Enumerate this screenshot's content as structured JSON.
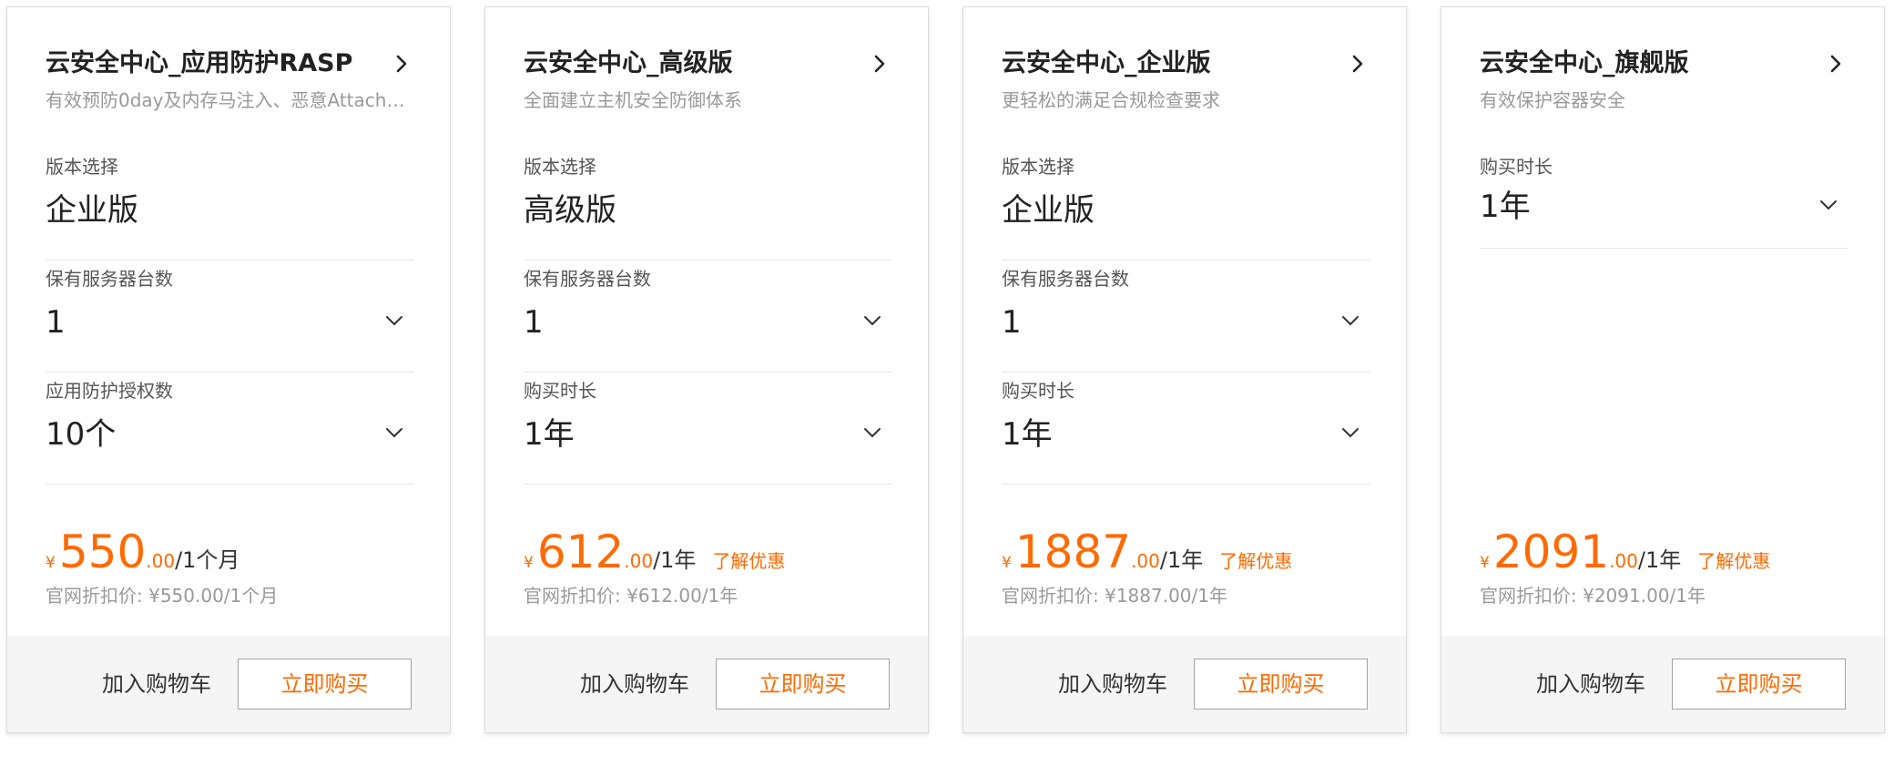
{
  "cards": [
    {
      "title": "云安全中心_应用防护RASP",
      "desc": "有效预防0day及内存马注入、恶意Attach…",
      "options": [
        {
          "label": "版本选择",
          "value": "企业版"
        },
        {
          "label": "保有服务器台数",
          "value": "1"
        },
        {
          "label": "应用防护授权数",
          "value": "10个"
        }
      ],
      "price": {
        "currency": "¥",
        "amount": "550",
        "decimal": ".00",
        "unit": "/1个月",
        "deal": ""
      },
      "official_price": "官网折扣价: ¥550.00/1个月",
      "cart_label": "加入购物车",
      "buy_label": "立即购买"
    },
    {
      "title": "云安全中心_高级版",
      "desc": "全面建立主机安全防御体系",
      "options": [
        {
          "label": "版本选择",
          "value": "高级版"
        },
        {
          "label": "保有服务器台数",
          "value": "1"
        },
        {
          "label": "购买时长",
          "value": "1年"
        }
      ],
      "price": {
        "currency": "¥",
        "amount": "612",
        "decimal": ".00",
        "unit": "/1年",
        "deal": "了解优惠"
      },
      "official_price": "官网折扣价: ¥612.00/1年",
      "cart_label": "加入购物车",
      "buy_label": "立即购买"
    },
    {
      "title": "云安全中心_企业版",
      "desc": "更轻松的满足合规检查要求",
      "options": [
        {
          "label": "版本选择",
          "value": "企业版"
        },
        {
          "label": "保有服务器台数",
          "value": "1"
        },
        {
          "label": "购买时长",
          "value": "1年"
        }
      ],
      "price": {
        "currency": "¥",
        "amount": "1887",
        "decimal": ".00",
        "unit": "/1年",
        "deal": "了解优惠"
      },
      "official_price": "官网折扣价: ¥1887.00/1年",
      "cart_label": "加入购物车",
      "buy_label": "立即购买"
    },
    {
      "title": "云安全中心_旗舰版",
      "desc": "有效保护容器安全",
      "options": [
        {
          "label": "购买时长",
          "value": "1年"
        }
      ],
      "price": {
        "currency": "¥",
        "amount": "2091",
        "decimal": ".00",
        "unit": "/1年",
        "deal": "了解优惠"
      },
      "official_price": "官网折扣价: ¥2091.00/1年",
      "cart_label": "加入购物车",
      "buy_label": "立即购买"
    }
  ],
  "icons": {
    "title_arrow": "chevron-right-icon",
    "dropdown": "chevron-down-icon"
  },
  "colors": {
    "accent": "#ff6a00",
    "footer_bg": "#f5f5f5",
    "muted_text": "#999999"
  }
}
